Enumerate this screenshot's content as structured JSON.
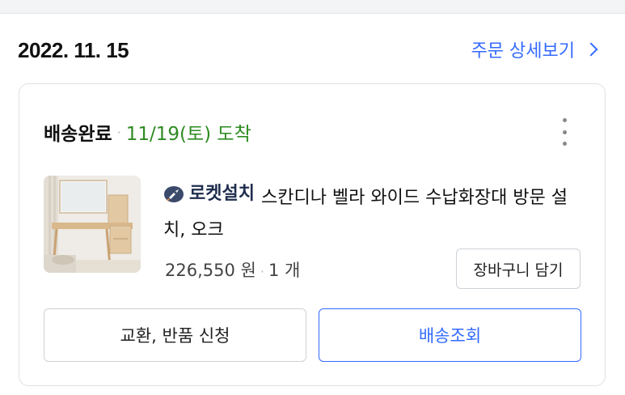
{
  "order": {
    "date": "2022. 11. 15",
    "detail_link": "주문 상세보기",
    "detail_icon": "chevron-right-icon"
  },
  "shipment": {
    "status": "배송완료",
    "arrival": "11/19(토) 도착",
    "arrival_color": "#2e8b22",
    "more_icon": "more-vertical-icon"
  },
  "product": {
    "badge": "로켓설치",
    "badge_icon": "rocket-icon",
    "name": "스칸디나 벨라 와이드 수납화장대 방문 설치, 오크",
    "price": "226,550 원",
    "quantity": "1 개",
    "cart_button": "장바구니 담기"
  },
  "actions": {
    "exchange_return": "교환, 반품 신청",
    "track_delivery": "배송조회"
  },
  "colors": {
    "accent": "#346aff",
    "arrival_green": "#2e8b22"
  }
}
